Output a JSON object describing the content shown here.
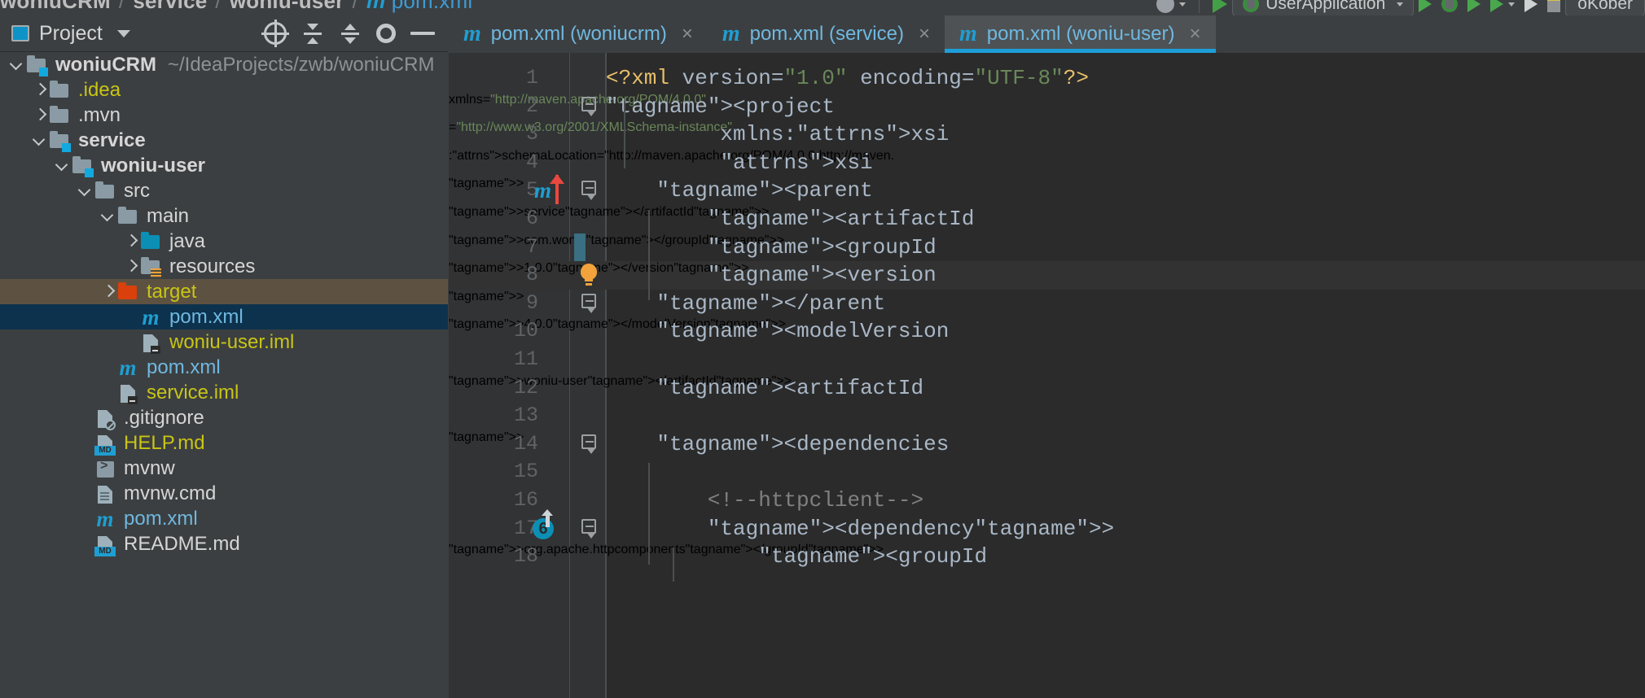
{
  "breadcrumb": {
    "items": [
      "woniuCRM",
      "service",
      "woniu-user"
    ],
    "file": "pom.xml",
    "separator": "/"
  },
  "toolbar_right": {
    "run_config_label": "UserApplication",
    "search_label": "oKober",
    "icons": [
      "avatar-icon",
      "run-icon",
      "debug-icon",
      "coverage-icon",
      "profile-icon",
      "rerun-icon",
      "stop-icon"
    ]
  },
  "tool_window": {
    "title": "Project",
    "icon": "project-icon",
    "actions": [
      "locate-icon",
      "collapse-all-icon",
      "expand-icon",
      "settings-gear-icon",
      "hide-icon"
    ]
  },
  "project_tree": [
    {
      "label": "woniuCRM",
      "path": "~/IdeaProjects/zwb/woniuCRM",
      "indent": 0,
      "chevron": "down",
      "icon": "module-folder-icon",
      "style": "bold"
    },
    {
      "label": ".idea",
      "path": "",
      "indent": 1,
      "chevron": "right",
      "icon": "folder-icon",
      "style": "yellow"
    },
    {
      "label": ".mvn",
      "path": "",
      "indent": 1,
      "chevron": "right",
      "icon": "folder-icon",
      "style": "grey"
    },
    {
      "label": "service",
      "path": "",
      "indent": 1,
      "chevron": "down",
      "icon": "module-folder-icon",
      "style": "bold"
    },
    {
      "label": "woniu-user",
      "path": "",
      "indent": 2,
      "chevron": "down",
      "icon": "module-folder-icon",
      "style": "bold"
    },
    {
      "label": "src",
      "path": "",
      "indent": 3,
      "chevron": "down",
      "icon": "folder-icon",
      "style": "grey"
    },
    {
      "label": "main",
      "path": "",
      "indent": 4,
      "chevron": "down",
      "icon": "folder-icon",
      "style": "grey"
    },
    {
      "label": "java",
      "path": "",
      "indent": 5,
      "chevron": "right",
      "icon": "sources-folder-icon",
      "style": "grey"
    },
    {
      "label": "resources",
      "path": "",
      "indent": 5,
      "chevron": "right",
      "icon": "resources-folder-icon",
      "style": "grey"
    },
    {
      "label": "target",
      "path": "",
      "indent": 4,
      "chevron": "right",
      "icon": "excluded-folder-icon",
      "style": "yellow",
      "state": "sel-target"
    },
    {
      "label": "pom.xml",
      "path": "",
      "indent": 5,
      "chevron": "none",
      "icon": "maven-icon",
      "style": "blue",
      "state": "sel-file"
    },
    {
      "label": "woniu-user.iml",
      "path": "",
      "indent": 5,
      "chevron": "none",
      "icon": "iml-icon",
      "style": "yellow"
    },
    {
      "label": "pom.xml",
      "path": "",
      "indent": 4,
      "chevron": "none",
      "icon": "maven-icon",
      "style": "blue"
    },
    {
      "label": "service.iml",
      "path": "",
      "indent": 4,
      "chevron": "none",
      "icon": "iml-icon",
      "style": "yellow"
    },
    {
      "label": ".gitignore",
      "path": "",
      "indent": 3,
      "chevron": "none",
      "icon": "gitignore-icon",
      "style": "grey"
    },
    {
      "label": "HELP.md",
      "path": "",
      "indent": 3,
      "chevron": "none",
      "icon": "markdown-icon",
      "style": "yellow"
    },
    {
      "label": "mvnw",
      "path": "",
      "indent": 3,
      "chevron": "none",
      "icon": "shell-script-icon",
      "style": "grey"
    },
    {
      "label": "mvnw.cmd",
      "path": "",
      "indent": 3,
      "chevron": "none",
      "icon": "text-file-icon",
      "style": "grey"
    },
    {
      "label": "pom.xml",
      "path": "",
      "indent": 3,
      "chevron": "none",
      "icon": "maven-icon",
      "style": "blue"
    },
    {
      "label": "README.md",
      "path": "",
      "indent": 3,
      "chevron": "none",
      "icon": "markdown-icon",
      "style": "grey"
    }
  ],
  "editor_tabs": [
    {
      "label": "pom.xml (woniucrm)",
      "icon": "maven-icon",
      "active": false,
      "close": "×"
    },
    {
      "label": "pom.xml (service)",
      "icon": "maven-icon",
      "active": false,
      "close": "×"
    },
    {
      "label": "pom.xml (woniu-user)",
      "icon": "maven-icon",
      "active": true,
      "close": "×"
    }
  ],
  "editor": {
    "file": "pom.xml",
    "language": "xml",
    "lines": [
      {
        "n": 1,
        "text": "<?xml version=\"1.0\" encoding=\"UTF-8\"?>"
      },
      {
        "n": 2,
        "text": "<project xmlns=\"http://maven.apache.org/POM/4.0.0\"",
        "fold": true
      },
      {
        "n": 3,
        "text": "         xmlns:xsi=\"http://www.w3.org/2001/XMLSchema-instance\""
      },
      {
        "n": 4,
        "text": "         xsi:schemaLocation=\"http://maven.apache.org/POM/4.0.0 http://maven."
      },
      {
        "n": 5,
        "text": "    <parent>",
        "fold": true,
        "gutter": "maven-parent-icon",
        "marker": "red-up-arrow"
      },
      {
        "n": 6,
        "text": "        <artifactId>service</artifactId>"
      },
      {
        "n": 7,
        "text": "        <groupId>com.woniu</groupId>",
        "caret": true
      },
      {
        "n": 8,
        "text": "        <version>1.0.0</version>",
        "gutter": "lightbulb-icon",
        "highlight": "selection",
        "current": true
      },
      {
        "n": 9,
        "text": "    </parent>",
        "fold": true
      },
      {
        "n": 10,
        "text": "    <modelVersion>4.0.0</modelVersion>"
      },
      {
        "n": 11,
        "text": ""
      },
      {
        "n": 12,
        "text": "    <artifactId>woniu-user</artifactId>"
      },
      {
        "n": 13,
        "text": ""
      },
      {
        "n": 14,
        "text": "    <dependencies>",
        "fold": true
      },
      {
        "n": 15,
        "text": ""
      },
      {
        "n": 16,
        "text": "        <!--httpclient-->"
      },
      {
        "n": 17,
        "text": "        <dependency>",
        "fold": true,
        "gutter": "usages-6-icon",
        "highlight": "soft"
      },
      {
        "n": 18,
        "text": "            <groupId>org.apache.httpcomponents</groupId>"
      }
    ]
  },
  "colors": {
    "accent": "#1d9ed9",
    "tag": "#e8bf6a",
    "string": "#6a8759",
    "comment": "#808080",
    "text": "#a9b7c6",
    "editor_bg": "#2b2b2b",
    "panel_bg": "#3c3f41",
    "selection_blue": "#0d324d",
    "selection_brown": "#5d5242",
    "highlight_teal": "#2e5a53",
    "highlight_olive": "#5f5229"
  }
}
